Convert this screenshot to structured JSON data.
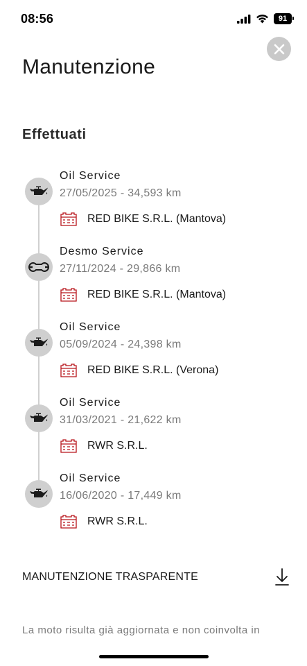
{
  "status_bar": {
    "time": "08:56",
    "battery": "91"
  },
  "header": {
    "title": "Manutenzione",
    "close_icon": "close-icon"
  },
  "section": {
    "title": "Effettuati"
  },
  "entries": [
    {
      "title": "Oil Service",
      "details": "27/05/2025 - 34,593 km",
      "dealer": "RED BIKE S.R.L. (Mantova)",
      "icon": "oil-can-icon"
    },
    {
      "title": "Desmo Service",
      "details": "27/11/2024 - 29,866 km",
      "dealer": "RED BIKE S.R.L. (Mantova)",
      "icon": "wrench-icon"
    },
    {
      "title": "Oil Service",
      "details": "05/09/2024 - 24,398 km",
      "dealer": "RED BIKE S.R.L. (Verona)",
      "icon": "oil-can-icon"
    },
    {
      "title": "Oil Service",
      "details": "31/03/2021 - 21,622 km",
      "dealer": "RWR S.R.L.",
      "icon": "oil-can-icon"
    },
    {
      "title": "Oil Service",
      "details": "16/06/2020 - 17,449 km",
      "dealer": "RWR S.R.L.",
      "icon": "oil-can-icon"
    }
  ],
  "transparent": {
    "label": "MANUTENZIONE TRASPARENTE",
    "icon": "download-icon"
  },
  "footer": {
    "text": "La moto risulta già aggiornata e non coinvolta in"
  },
  "colors": {
    "accent": "#b8141a",
    "icon_bg": "#cfcfcf",
    "muted": "#7a7a7a"
  }
}
